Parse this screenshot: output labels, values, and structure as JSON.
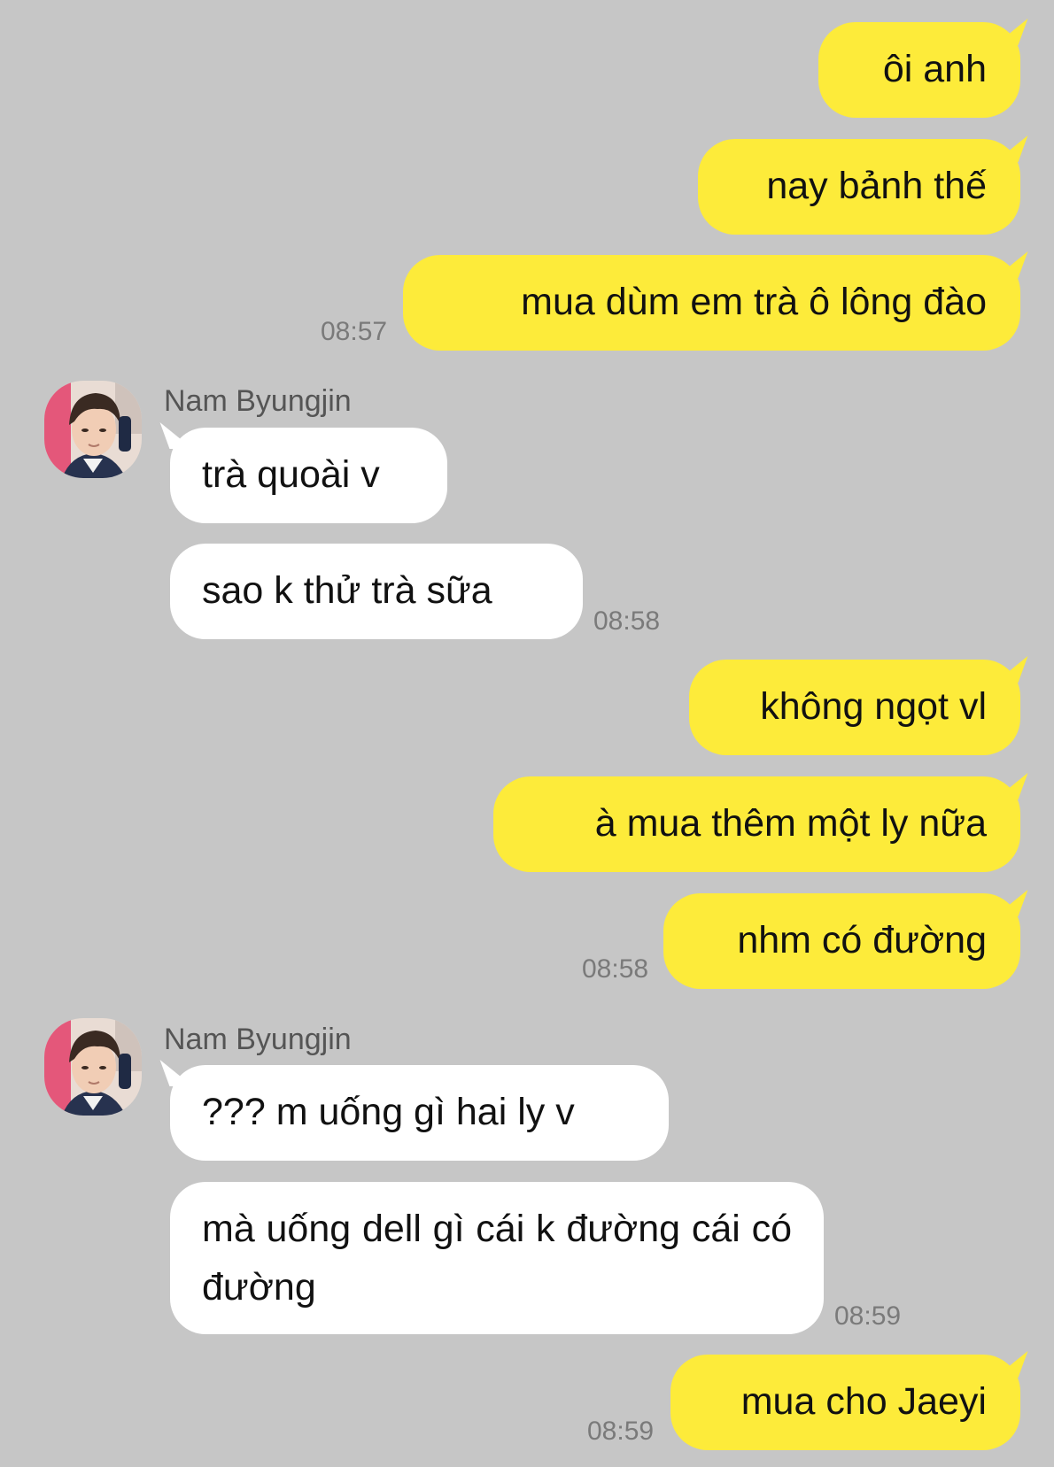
{
  "colors": {
    "background": "#c6c6c6",
    "outgoing_bubble": "#fdeb3a",
    "incoming_bubble": "#ffffff",
    "timestamp": "#7a7a7a"
  },
  "messages": {
    "m1": "ôi anh",
    "m2": "nay bảnh thế",
    "m3": "mua dùm em trà ô lông đào",
    "t1": "08:57",
    "sender1": "Nam Byungjin",
    "m4": "trà quoài v",
    "m5": "sao k thử trà sữa",
    "t2": "08:58",
    "m6": "không ngọt vl",
    "m7": "à mua thêm một ly nữa",
    "m8": "nhm có đường",
    "t3": "08:58",
    "sender2": "Nam Byungjin",
    "m9": "??? m uống gì hai ly v",
    "m10": "mà uống dell gì cái k đường cái có đường",
    "t4": "08:59",
    "m11": "mua cho Jaeyi",
    "t5": "08:59"
  }
}
